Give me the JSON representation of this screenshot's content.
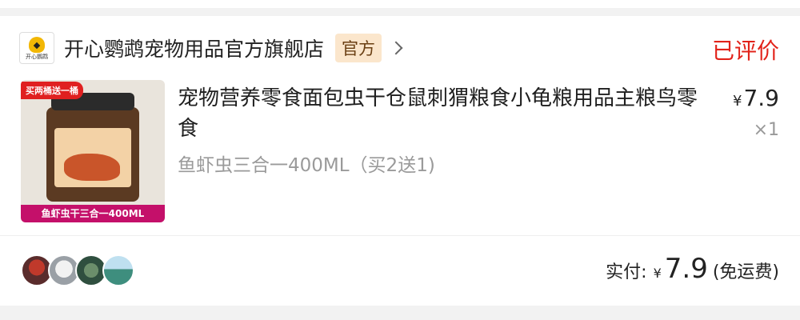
{
  "shop": {
    "name": "开心鹦鹉宠物用品官方旗舰店",
    "badge": "官方",
    "logo_text": "开心鹦鹉"
  },
  "order_status": "已评价",
  "product": {
    "image_ribbon_top": "买两桶送一桶",
    "image_ribbon_bottom": "鱼虾虫干三合一400ML",
    "title": "宠物营养零食面包虫干仓鼠刺猬粮食小龟粮用品主粮鸟零食",
    "price_currency": "¥",
    "price_value": "7.9",
    "quantity": "×1",
    "variant": "鱼虾虫三合一400ML（买2送1)"
  },
  "payment": {
    "label": "实付:",
    "currency": "¥",
    "amount": "7.9",
    "note": "(免运费)"
  },
  "colors": {
    "status_red": "#e2231a",
    "badge_bg": "#fbe6cc",
    "badge_text": "#6a3f13"
  }
}
